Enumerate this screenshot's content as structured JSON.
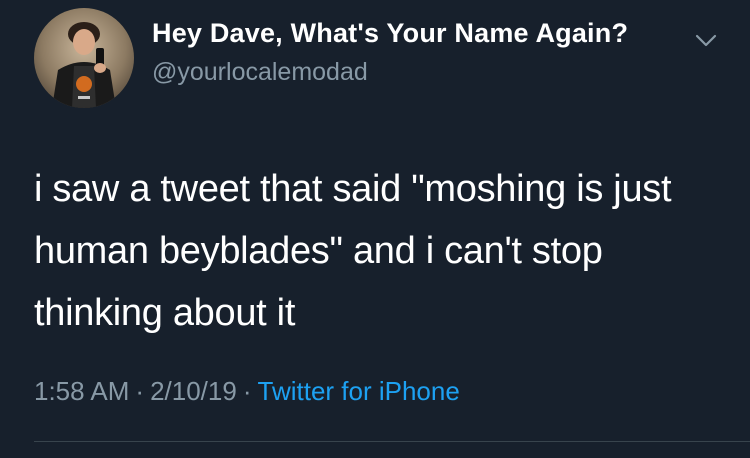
{
  "user": {
    "display_name": "Hey Dave, What's Your Name Again?",
    "handle": "@yourlocalemodad",
    "avatar_icon": "profile-photo"
  },
  "tweet": {
    "text": "i saw a tweet that said \"moshing is just human beyblades\" and i can't stop thinking about it",
    "time": "1:58 AM",
    "date": "2/10/19",
    "separator": "·",
    "source": "Twitter for iPhone"
  },
  "icons": {
    "menu": "chevron-down-icon"
  },
  "colors": {
    "background": "#17202c",
    "text": "#ffffff",
    "muted": "#8899a6",
    "link": "#1da1f2"
  }
}
